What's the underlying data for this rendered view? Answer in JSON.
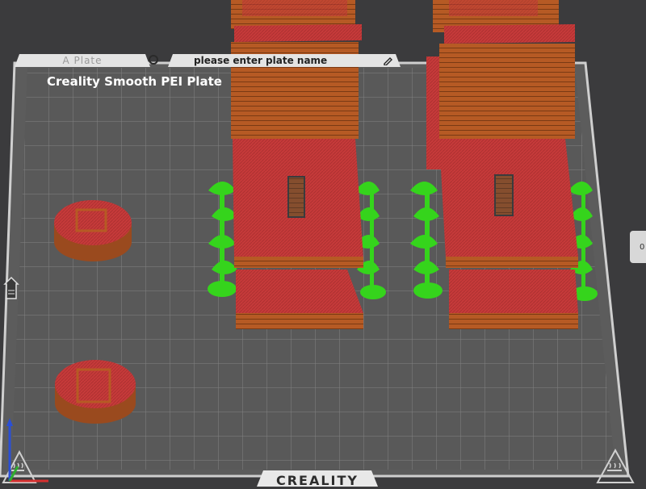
{
  "plate": {
    "tab_label": "A Plate",
    "name": "please enter plate name",
    "bed_label": "Creality Smooth PEI Plate",
    "brand": "CREALITY"
  },
  "side_button": {
    "label": "0"
  },
  "icons": {
    "plate_settings": "circle-icon",
    "edit": "pencil-icon",
    "home_view": "house-icon",
    "heated_bed": "heated-bed-icon",
    "axes": "xyz-axes-icon"
  },
  "colors": {
    "background": "#3b3b3d",
    "bed": "#595959",
    "grid": "#8a8a8a",
    "model_red": "#c63a3a",
    "model_orange": "#b65a24",
    "support_green": "#35d41c",
    "bed_border": "#d2d2d2"
  }
}
